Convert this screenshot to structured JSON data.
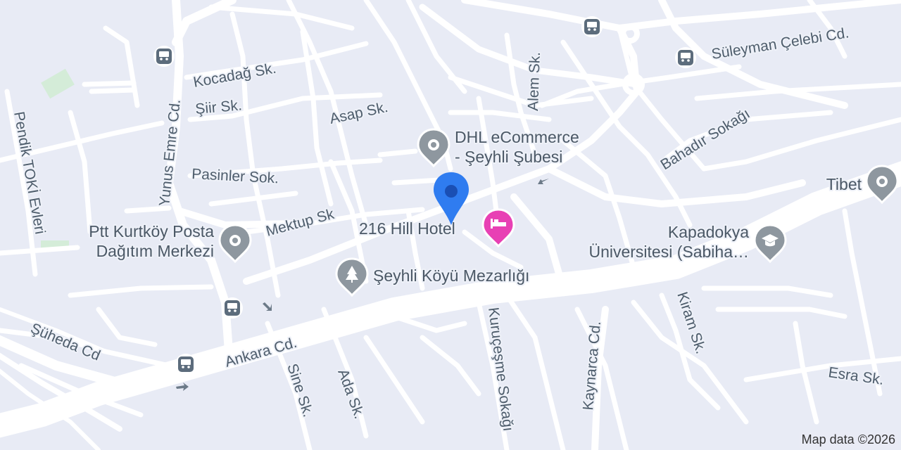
{
  "streets": {
    "kocadag": "Kocadağ Sk.",
    "siir": "Şiir Sk.",
    "asap": "Asap Sk.",
    "alem": "Alem Sk.",
    "suleyman": "Süleyman Çelebi Cd.",
    "bahadir": "Bahadır Sokağı",
    "yunus_emre": "Yunus Emre Cd.",
    "pendik_toki": "Pendik TOKİ Evleri",
    "pasinler": "Pasinler Sok.",
    "mektup": "Mektup Sk",
    "ankara": "Ankara Cd.",
    "suheda": "Şüheda Cd",
    "sine": "Sine Sk.",
    "ada": "Ada Sk.",
    "kurucesme": "Kuruçeşme Sokağı",
    "kaynarca": "Kaynarca Cd.",
    "kiram": "Kiram Sk.",
    "esra": "Esra Sk."
  },
  "pois": {
    "dhl_line1": "DHL eCommerce",
    "dhl_line2": "- Şeyhli Şubesi",
    "hotel": "216 Hill Hotel",
    "ptt_line1": "Ptt Kurtköy Posta",
    "ptt_line2": "Dağıtım Merkezi",
    "cemetery": "Şeyhli Köyü Mezarlığı",
    "kapadokya_line1": "Kapadokya",
    "kapadokya_line2": "Üniversitesi (Sabiha…",
    "tibet": "Tibet"
  },
  "icons": {
    "bus_stop": "bus-stop-icon",
    "place": "place-icon",
    "hotel": "hotel-icon",
    "cemetery": "cemetery-icon",
    "university": "university-icon",
    "pin": "location-pin-icon",
    "arrow": "one-way-arrow-icon"
  },
  "colors": {
    "background": "#e8ebf5",
    "road": "#ffffff",
    "park": "#d4ecd8",
    "label": "#4e5d6c",
    "poi_gray": "#8e979f",
    "hotel_pink": "#e840b4",
    "pin_blue": "#2f7cf0",
    "pin_dot": "#1a4fb4"
  },
  "attribution": "Map data ©2026"
}
